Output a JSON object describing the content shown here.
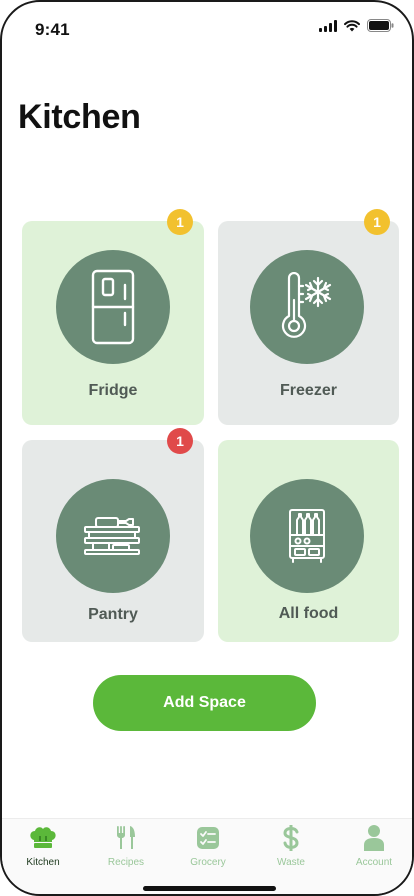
{
  "status_bar": {
    "time": "9:41"
  },
  "header": {
    "title": "Kitchen"
  },
  "spaces": [
    {
      "label": "Fridge",
      "badge": "1",
      "badge_color": "#f2c12e",
      "icon": "fridge-icon",
      "background": "#dff2d8"
    },
    {
      "label": "Freezer",
      "badge": "1",
      "badge_color": "#f2c12e",
      "icon": "thermometer-snowflake-icon",
      "background": "#e6e9e8"
    },
    {
      "label": "Pantry",
      "badge": "1",
      "badge_color": "#e04a4a",
      "icon": "pantry-shelf-icon",
      "background": "#e6e9e8"
    },
    {
      "label": "All food",
      "icon": "food-cabinet-icon",
      "background": "#dff2d8"
    }
  ],
  "add_space": {
    "label": "Add Space",
    "color": "#5bb83a"
  },
  "tab_bar": {
    "items": [
      {
        "label": "Kitchen",
        "icon": "chef-hat-icon",
        "active": true
      },
      {
        "label": "Recipes",
        "icon": "fork-knife-icon",
        "active": false
      },
      {
        "label": "Grocery",
        "icon": "checklist-icon",
        "active": false
      },
      {
        "label": "Waste",
        "icon": "dollar-icon",
        "active": false
      },
      {
        "label": "Account",
        "icon": "person-icon",
        "active": false
      }
    ]
  },
  "colors": {
    "accent_green": "#5bb83a",
    "circle": "#6a8b76",
    "tab_inactive": "#9ac79a",
    "tab_active": "#1e3a1e"
  }
}
